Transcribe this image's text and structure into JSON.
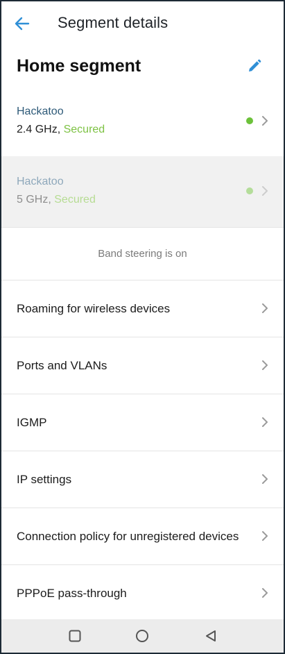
{
  "appbar": {
    "title": "Segment details",
    "back_icon": "arrow-left-icon"
  },
  "segment": {
    "name": "Home segment",
    "edit_icon": "pencil-icon"
  },
  "networks": [
    {
      "ssid": "Hackatoo",
      "band": "2.4 GHz,",
      "security": "Secured",
      "status_color": "#6cc13a",
      "disabled": false
    },
    {
      "ssid": "Hackatoo",
      "band": "5 GHz,",
      "security": "Secured",
      "status_color": "#b4dd9a",
      "disabled": true
    }
  ],
  "band_steering": "Band steering is on",
  "menu": [
    {
      "label": "Roaming for wireless devices"
    },
    {
      "label": "Ports and VLANs"
    },
    {
      "label": "IGMP"
    },
    {
      "label": "IP settings"
    },
    {
      "label": "Connection policy for unregistered devices"
    },
    {
      "label": "PPPoE pass-through"
    }
  ],
  "system_nav": {
    "icons": [
      "square-recents-icon",
      "circle-home-icon",
      "triangle-back-icon"
    ]
  },
  "colors": {
    "accent": "#2f8fd6",
    "secured": "#7dc243",
    "ssid": "#2e5a78"
  }
}
